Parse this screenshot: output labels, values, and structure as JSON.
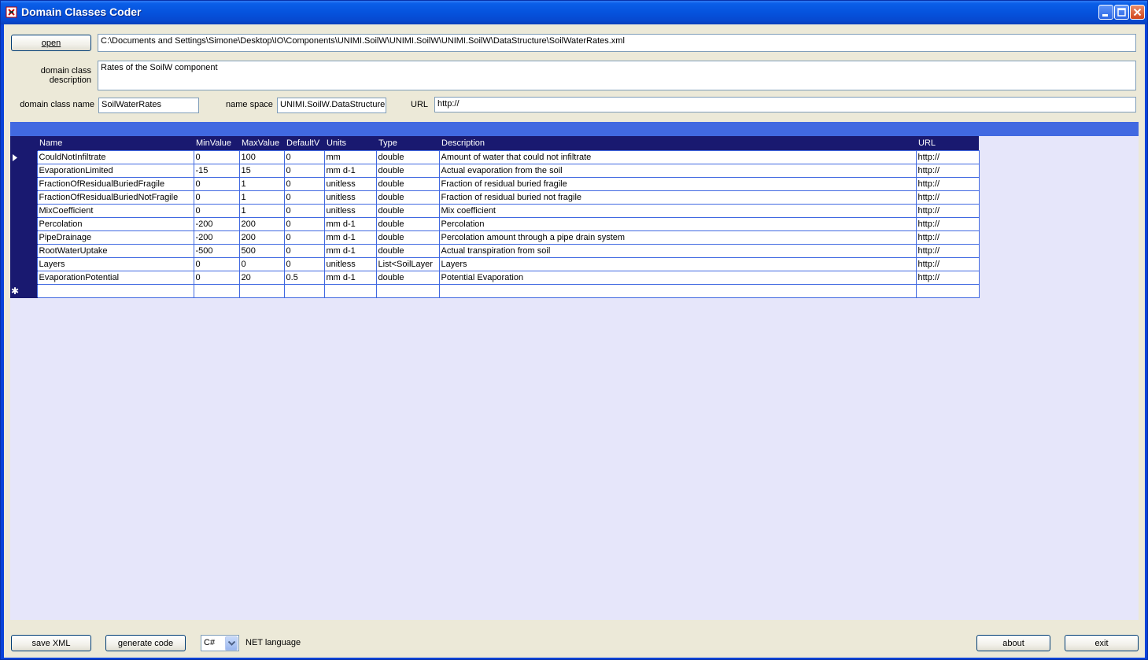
{
  "window": {
    "title": "Domain Classes Coder"
  },
  "toolbar": {
    "open_label": "open",
    "file_path": "C:\\Documents and Settings\\Simone\\Desktop\\IO\\Components\\UNIMI.SoilW\\UNIMI.SoilW\\UNIMI.SoilW\\DataStructure\\SoilWaterRates.xml"
  },
  "form": {
    "description_label": "domain class description",
    "description_value": "Rates of the SoilW component",
    "name_label": "domain class name",
    "name_value": "SoilWaterRates",
    "namespace_label": "name space",
    "namespace_value": "UNIMI.SoilW.DataStructure",
    "url_label": "URL",
    "url_value": "http://"
  },
  "grid": {
    "columns": [
      "Name",
      "MinValue",
      "MaxValue",
      "DefaultV",
      "Units",
      "Type",
      "Description",
      "URL"
    ],
    "rows": [
      [
        "CouldNotInfiltrate",
        "0",
        "100",
        "0",
        "mm",
        "double",
        "Amount of water that could not infiltrate",
        "http://"
      ],
      [
        "EvaporationLimited",
        "-15",
        "15",
        "0",
        "mm d-1",
        "double",
        "Actual evaporation from the soil",
        "http://"
      ],
      [
        "FractionOfResidualBuriedFragile",
        "0",
        "1",
        "0",
        "unitless",
        "double",
        "Fraction of residual buried fragile",
        "http://"
      ],
      [
        "FractionOfResidualBuriedNotFragile",
        "0",
        "1",
        "0",
        "unitless",
        "double",
        "Fraction of residual buried not fragile",
        "http://"
      ],
      [
        "MixCoefficient",
        "0",
        "1",
        "0",
        "unitless",
        "double",
        "Mix coefficient",
        "http://"
      ],
      [
        "Percolation",
        "-200",
        "200",
        "0",
        "mm d-1",
        "double",
        "Percolation",
        "http://"
      ],
      [
        "PipeDrainage",
        "-200",
        "200",
        "0",
        "mm d-1",
        "double",
        "Percolation amount through a pipe drain system",
        "http://"
      ],
      [
        "RootWaterUptake",
        "-500",
        "500",
        "0",
        "mm d-1",
        "double",
        "Actual transpiration from soil",
        "http://"
      ],
      [
        "Layers",
        "0",
        "0",
        "0",
        "unitless",
        "List<SoilLayer",
        "Layers",
        "http://"
      ],
      [
        "EvaporationPotential",
        "0",
        "20",
        "0.5",
        "mm d-1",
        "double",
        "Potential Evaporation",
        "http://"
      ]
    ],
    "current_row_icon": "row-pointer-icon",
    "new_row_icon": "new-row-asterisk-icon"
  },
  "footer": {
    "save_label": "save XML",
    "generate_label": "generate code",
    "language_value": "C#",
    "language_label": "NET language",
    "about_label": "about",
    "exit_label": "exit"
  },
  "colors": {
    "title_bar": "#0653dd",
    "grid_header": "#191970",
    "grid_border": "#4169e1",
    "grid_background": "#e6e6fa",
    "band": "#4169e1"
  }
}
